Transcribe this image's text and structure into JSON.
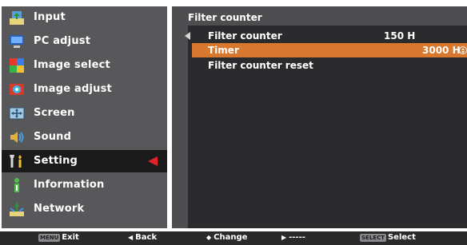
{
  "sidebar": {
    "items": [
      {
        "label": "Input",
        "icon": "input-icon"
      },
      {
        "label": "PC adjust",
        "icon": "pc-adjust-icon"
      },
      {
        "label": "Image select",
        "icon": "image-select-icon"
      },
      {
        "label": "Image adjust",
        "icon": "image-adjust-icon"
      },
      {
        "label": "Screen",
        "icon": "screen-icon"
      },
      {
        "label": "Sound",
        "icon": "sound-icon"
      },
      {
        "label": "Setting",
        "icon": "setting-icon"
      },
      {
        "label": "Information",
        "icon": "information-icon"
      },
      {
        "label": "Network",
        "icon": "network-icon"
      }
    ],
    "selected_index": 6
  },
  "panel": {
    "title": "Filter counter",
    "rows": [
      {
        "label": "Filter counter",
        "value": "150 H"
      },
      {
        "label": "Timer",
        "value": "3000 H"
      },
      {
        "label": "Filter counter reset",
        "value": ""
      }
    ],
    "active_row": 1
  },
  "footer": {
    "exit": {
      "key": "MENU",
      "label": "Exit"
    },
    "back": {
      "label": "Back"
    },
    "change": {
      "label": "Change"
    },
    "next": {
      "label": "-----"
    },
    "select": {
      "key": "SELECT",
      "label": "Select"
    }
  },
  "colors": {
    "sidebar_bg": "#58585a",
    "panel_bg": "#2b2b2d",
    "highlight": "#d8782e",
    "selector_arrow": "#e0232b"
  }
}
